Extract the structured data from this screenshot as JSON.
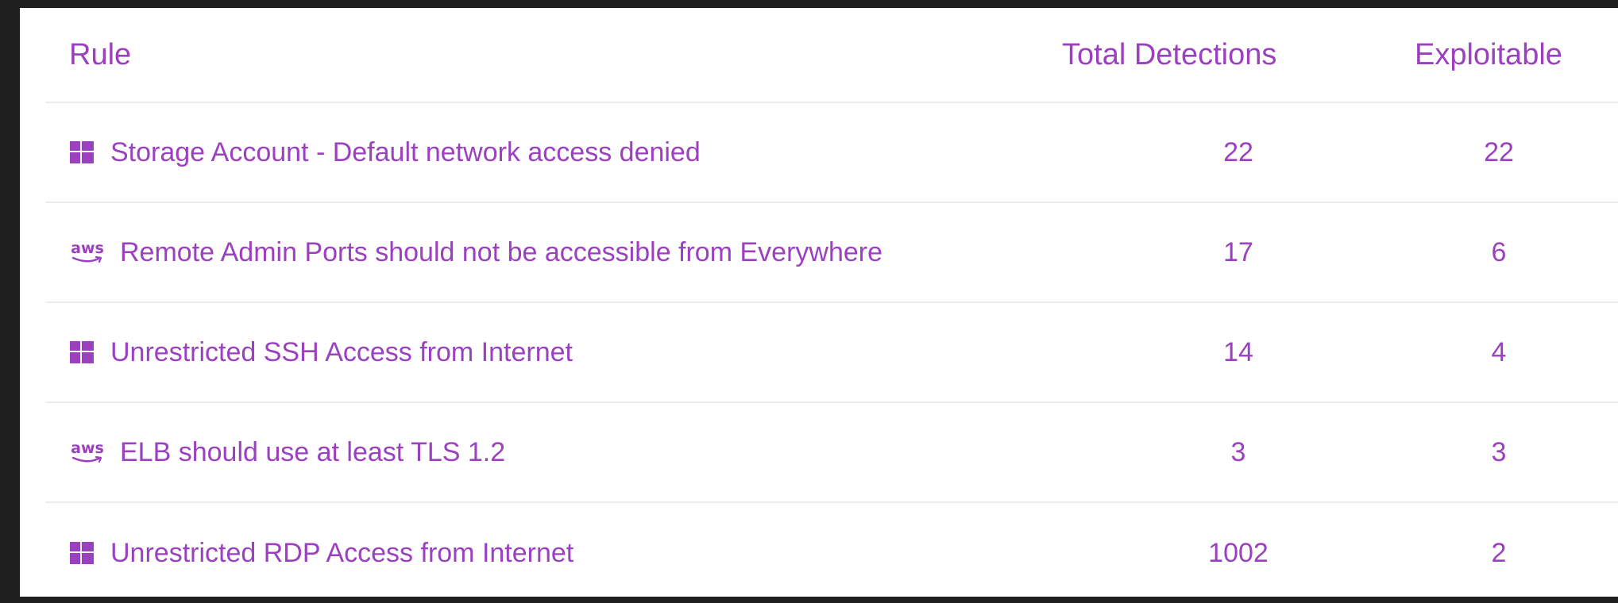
{
  "table": {
    "headers": {
      "rule": "Rule",
      "total": "Total Detections",
      "exploitable": "Exploitable"
    },
    "rows": [
      {
        "icon": "windows-icon",
        "rule": "Storage Account - Default network access denied",
        "total": "22",
        "exploitable": "22"
      },
      {
        "icon": "aws-icon",
        "rule": "Remote Admin Ports should not be accessible from Everywhere",
        "total": "17",
        "exploitable": "6"
      },
      {
        "icon": "windows-icon",
        "rule": "Unrestricted SSH Access from Internet",
        "total": "14",
        "exploitable": "4"
      },
      {
        "icon": "aws-icon",
        "rule": "ELB should use at least TLS 1.2",
        "total": "3",
        "exploitable": "3"
      },
      {
        "icon": "windows-icon",
        "rule": "Unrestricted RDP Access from Internet",
        "total": "1002",
        "exploitable": "2"
      }
    ]
  },
  "icons": {
    "aws_text": "aws"
  },
  "colors": {
    "text": "#9b40bf",
    "background": "#ffffff",
    "frame": "#1e1e1e",
    "divider": "#ececec"
  }
}
